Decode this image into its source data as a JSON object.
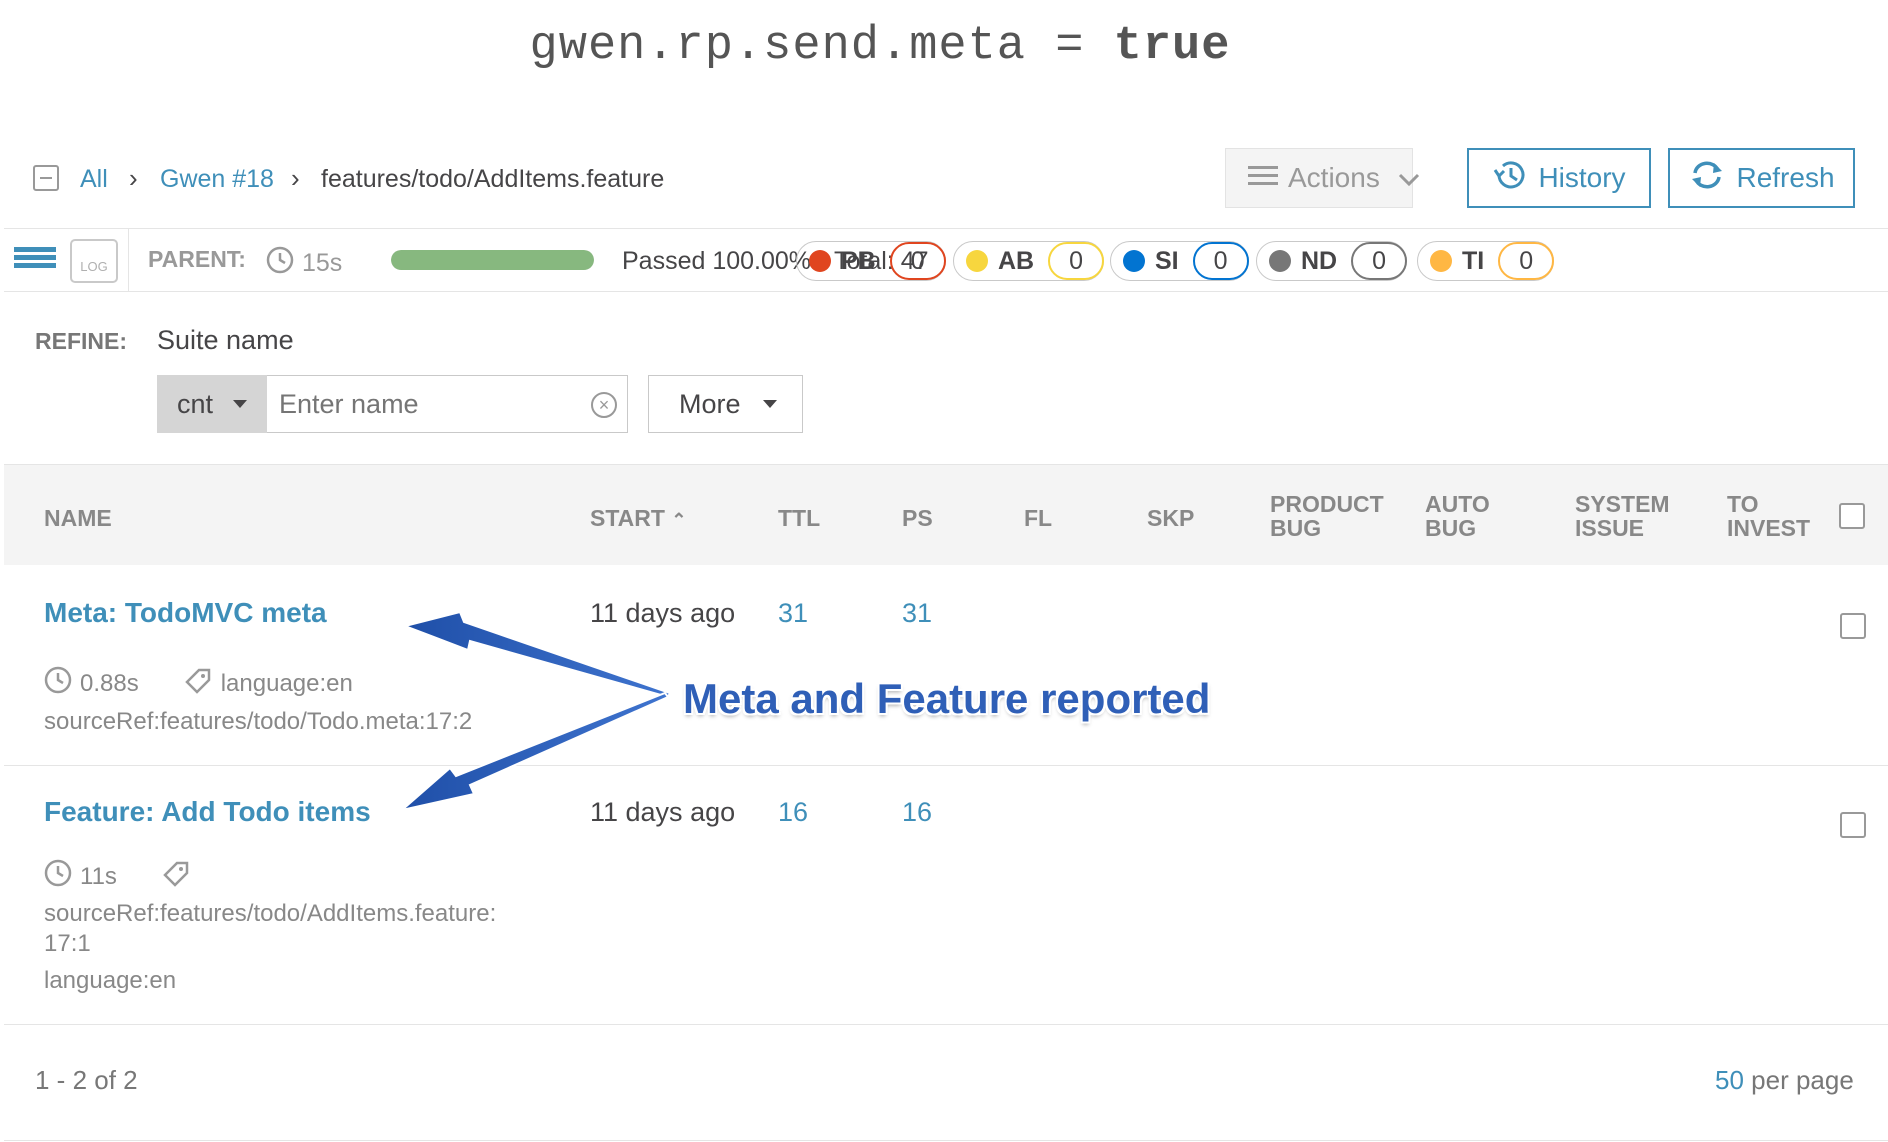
{
  "banner": {
    "prefix": "gwen.rp.send.meta = ",
    "value": "true"
  },
  "breadcrumb": {
    "all": "All",
    "launch": "Gwen #18",
    "current": "features/todo/AddItems.feature",
    "sep": "›"
  },
  "toolbar": {
    "actions_label": "Actions",
    "history_label": "History",
    "refresh_label": "Refresh"
  },
  "infobar": {
    "log_label": "LOG",
    "parent_label": "PARENT:",
    "parent_duration": "15s",
    "pass_rate": 1.0,
    "passed_text": "Passed 100.00%",
    "total_text": "Total: 47",
    "defects": [
      {
        "code": "PB",
        "count": "0",
        "color": "#e0451f"
      },
      {
        "code": "AB",
        "count": "0",
        "color": "#f7d63e"
      },
      {
        "code": "SI",
        "count": "0",
        "color": "#0274d1"
      },
      {
        "code": "ND",
        "count": "0",
        "color": "#777777"
      },
      {
        "code": "TI",
        "count": "0",
        "color": "#ffb743"
      }
    ]
  },
  "refine": {
    "label": "REFINE:",
    "suite_label": "Suite name",
    "condition": "cnt",
    "placeholder": "Enter name",
    "more_label": "More"
  },
  "table": {
    "headers": {
      "name": "NAME",
      "start": "START",
      "ttl": "TTL",
      "ps": "PS",
      "fl": "FL",
      "skp": "SKP",
      "product_bug_1": "PRODUCT",
      "product_bug_2": "BUG",
      "auto_bug_1": "AUTO",
      "auto_bug_2": "BUG",
      "system_issue_1": "SYSTEM",
      "system_issue_2": "ISSUE",
      "to_invest_1": "TO",
      "to_invest_2": "INVEST"
    },
    "rows": [
      {
        "name": "Meta: TodoMVC meta",
        "start": "11 days ago",
        "ttl": "31",
        "ps": "31",
        "duration": "0.88s",
        "attribute": "language:en",
        "source": "sourceRef:features/todo/Todo.meta:17:2"
      },
      {
        "name": "Feature: Add Todo items",
        "start": "11 days ago",
        "ttl": "16",
        "ps": "16",
        "duration": "11s",
        "source_line1": "sourceRef:features/todo/AddItems.feature:",
        "source_line2": "17:1",
        "attribute": "language:en"
      }
    ]
  },
  "annotation": "Meta and Feature reported",
  "footer": {
    "count_text": "1 - 2 of 2",
    "per_page_num": "50",
    "per_page_label": "per page"
  },
  "colors": {
    "accent": "#3f8fb9",
    "annotation": "#2f5fb7",
    "progress": "#87b87f"
  }
}
